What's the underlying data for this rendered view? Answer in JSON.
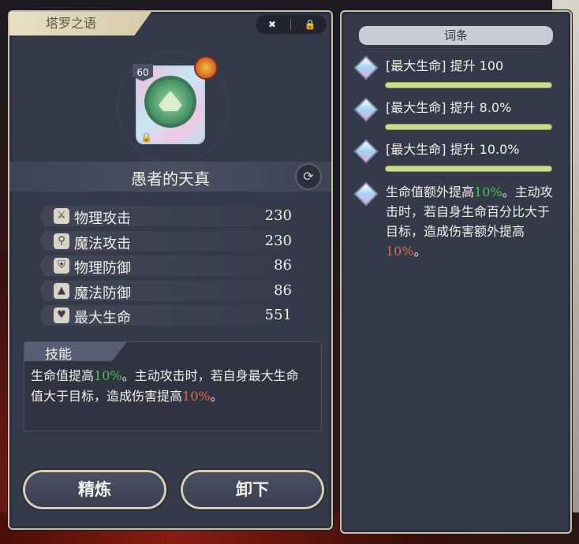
{
  "left_panel": {
    "title": "塔罗之语",
    "card": {
      "level": "60"
    },
    "name": "愚者的天真",
    "stats": [
      {
        "label": "物理攻击",
        "value": "230"
      },
      {
        "label": "魔法攻击",
        "value": "230"
      },
      {
        "label": "物理防御",
        "value": "86"
      },
      {
        "label": "魔法防御",
        "value": "86"
      },
      {
        "label": "最大生命",
        "value": "551"
      }
    ],
    "skill": {
      "header": "技能",
      "text_1": "生命值提高",
      "pct_1": "10%",
      "text_2": "。主动攻击时，若自身最大生命值大于目标，造成伤害提高",
      "pct_2": "10%",
      "text_3": "。"
    },
    "buttons": {
      "refine": "精炼",
      "unequip": "卸下"
    }
  },
  "right_panel": {
    "header": "词条",
    "entries": [
      {
        "text": "[最大生命] 提升 100"
      },
      {
        "text": "[最大生命] 提升 8.0%"
      },
      {
        "text": "[最大生命] 提升 10.0%"
      }
    ],
    "set_bonus": {
      "text_1": "生命值额外提高",
      "pct_1": "10%",
      "text_2": "。主动攻击时，若自身生命百分比大于目标，造成伤害额外提高",
      "pct_2": "10%",
      "text_3": "。"
    }
  },
  "colors": {
    "positive": "#4cc24a",
    "highlight": "#e26a45",
    "panel": "#353a4b",
    "trim": "#c9bfa0"
  }
}
